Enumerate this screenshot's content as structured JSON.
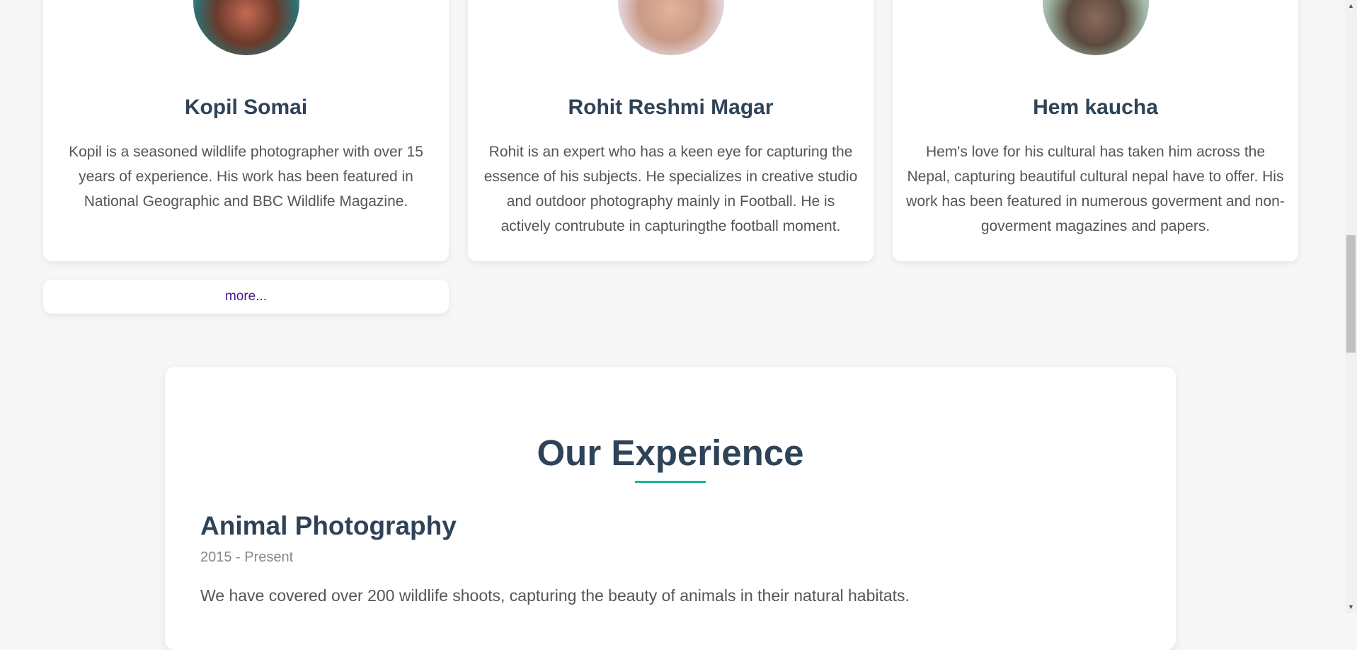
{
  "team": [
    {
      "name": "Kopil Somai",
      "bio": "Kopil is a seasoned wildlife photographer with over 15 years of experience. His work has been featured in National Geographic and BBC Wildlife Magazine."
    },
    {
      "name": "Rohit Reshmi Magar",
      "bio": "Rohit is an expert who has a keen eye for capturing the essence of his subjects. He specializes in creative studio and outdoor photography mainly in Football. He is actively contrubute in capturingthe football moment."
    },
    {
      "name": "Hem kaucha",
      "bio": "Hem's love for his cultural has taken him across the Nepal, capturing beautiful cultural nepal have to offer. His work has been featured in numerous goverment and non-goverment magazines and papers."
    }
  ],
  "more_label": "more...",
  "experience": {
    "heading": "Our Experience",
    "items": [
      {
        "title": "Animal Photography",
        "period": "2015 - Present",
        "description": "We have covered over 200 wildlife shoots, capturing the beauty of animals in their natural habitats."
      }
    ]
  },
  "scrollbar": {
    "up_icon": "▲",
    "down_icon": "▼"
  },
  "colors": {
    "heading": "#2e4358",
    "accent": "#1eb29c",
    "link": "#4b1d86"
  }
}
